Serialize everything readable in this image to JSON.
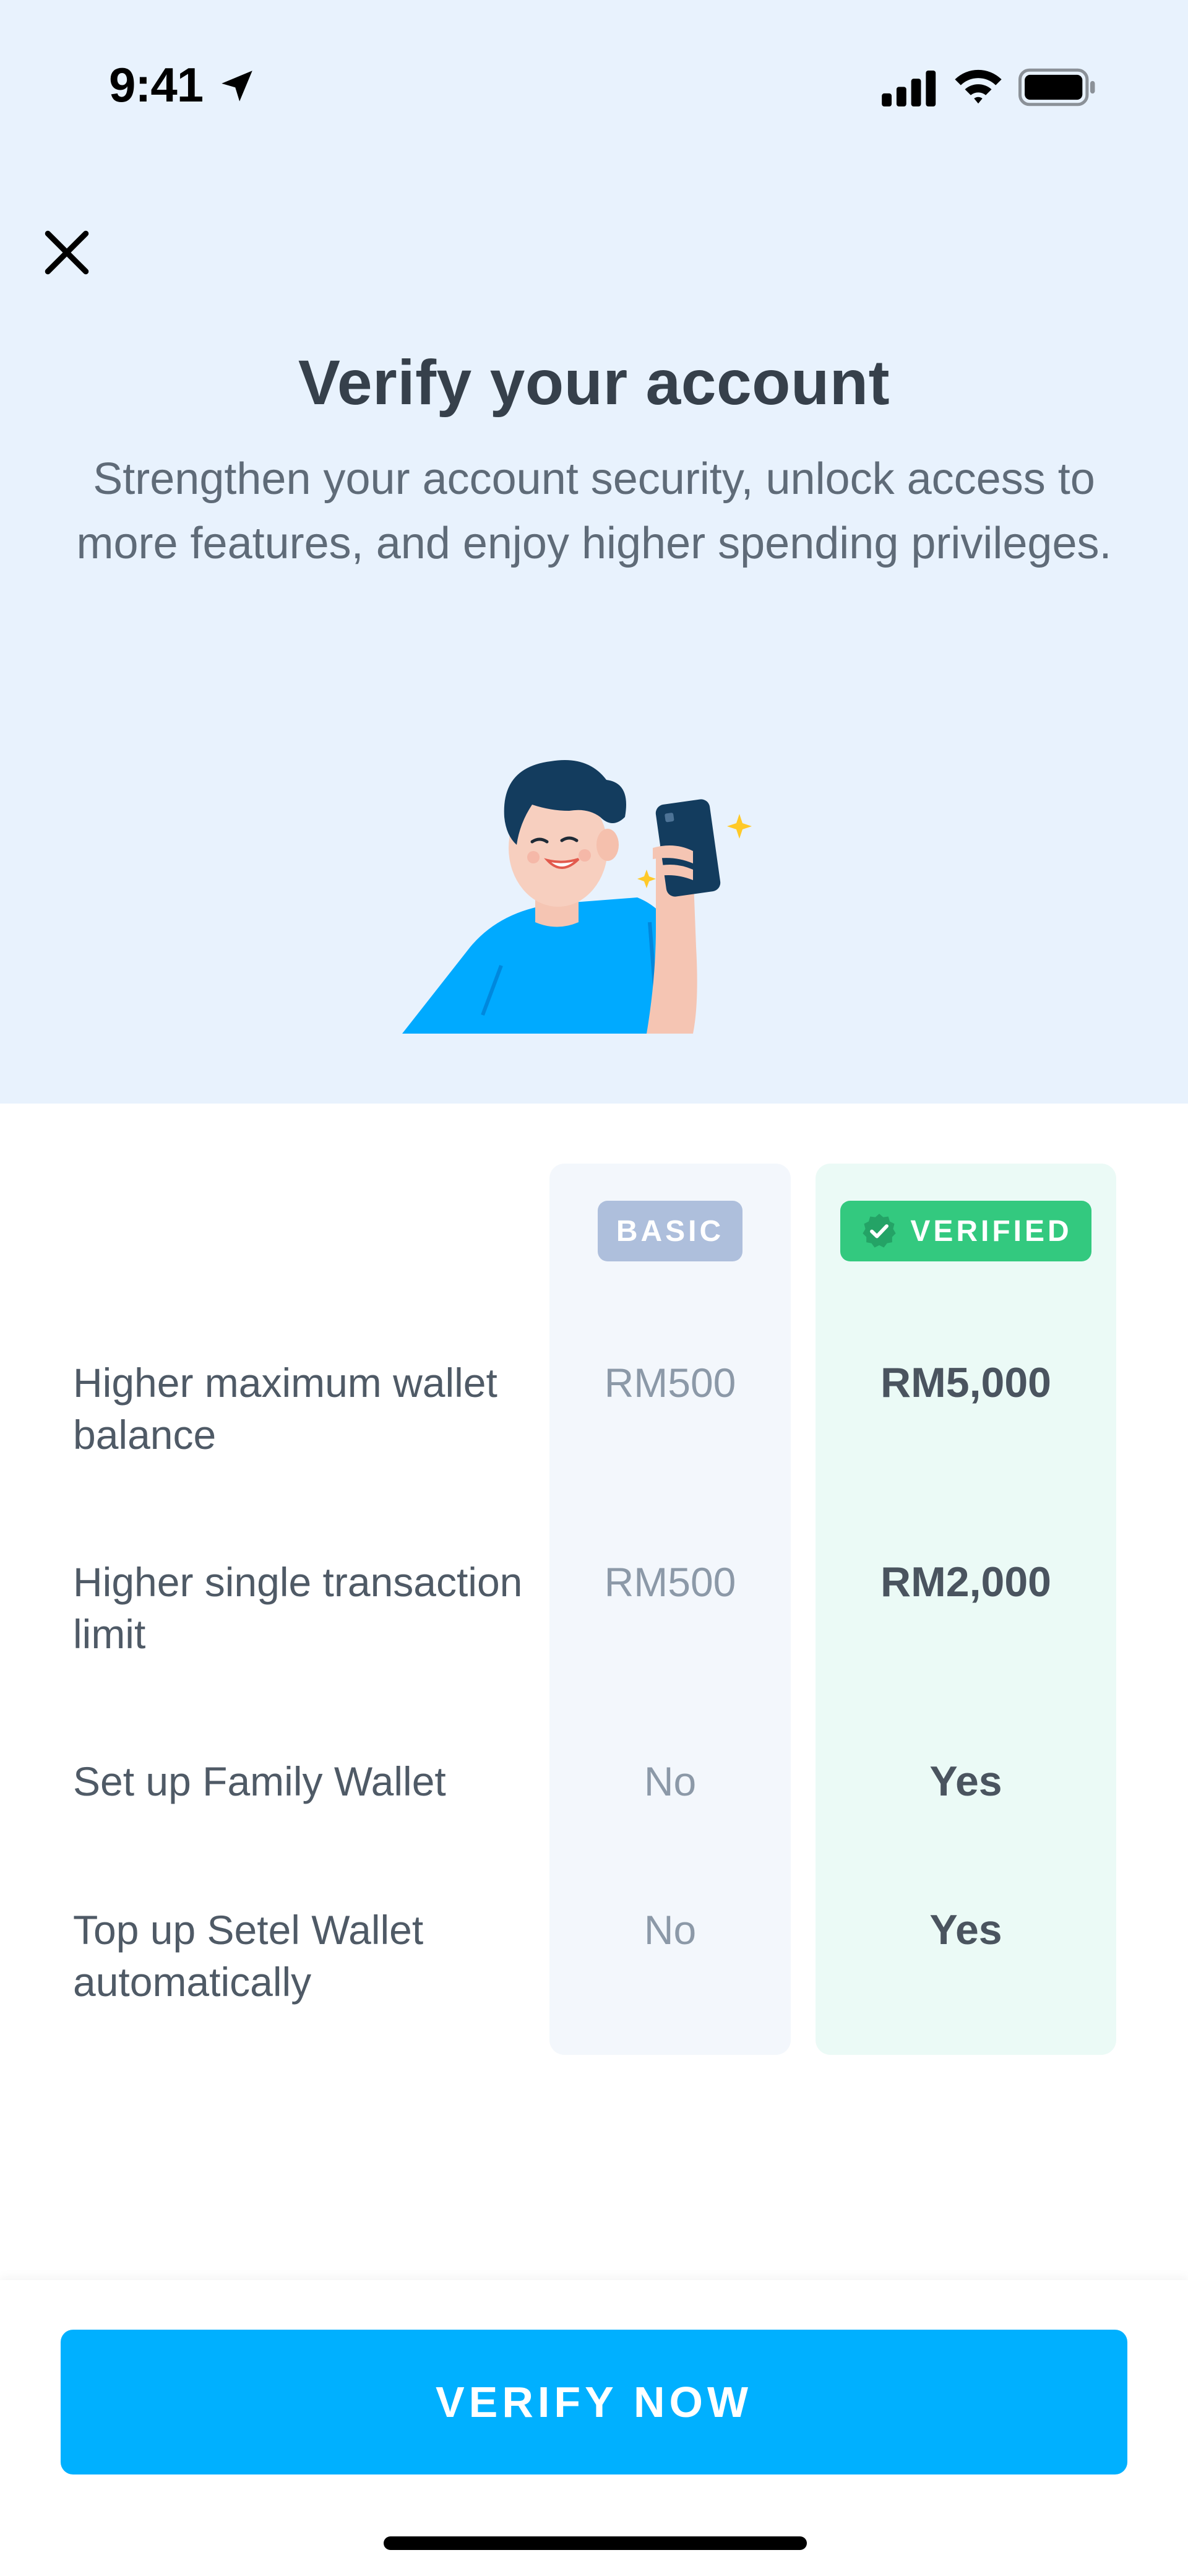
{
  "status_bar": {
    "time": "9:41"
  },
  "header": {
    "title": "Verify your account",
    "subtitle": "Strengthen your account security, unlock access to more features, and enjoy higher spending privileges."
  },
  "tiers": {
    "basic_label": "BASIC",
    "verified_label": "VERIFIED"
  },
  "rows": [
    {
      "label": "Higher maximum wallet balance",
      "basic": "RM500",
      "verified": "RM5,000"
    },
    {
      "label": "Higher single transaction limit",
      "basic": "RM500",
      "verified": "RM2,000"
    },
    {
      "label": "Set up Family Wallet",
      "basic": "No",
      "verified": "Yes"
    },
    {
      "label": "Top up Setel Wallet automatically",
      "basic": "No",
      "verified": "Yes"
    }
  ],
  "cta": {
    "label": "VERIFY NOW"
  },
  "colors": {
    "hero_bg": "#e8f2fd",
    "accent": "#00b0ff",
    "verified_green": "#33c97f",
    "basic_badge": "#aebfdc"
  },
  "icons": [
    "location-arrow-icon",
    "cellular-signal-icon",
    "wifi-icon",
    "battery-icon",
    "close-icon",
    "verified-check-icon"
  ]
}
